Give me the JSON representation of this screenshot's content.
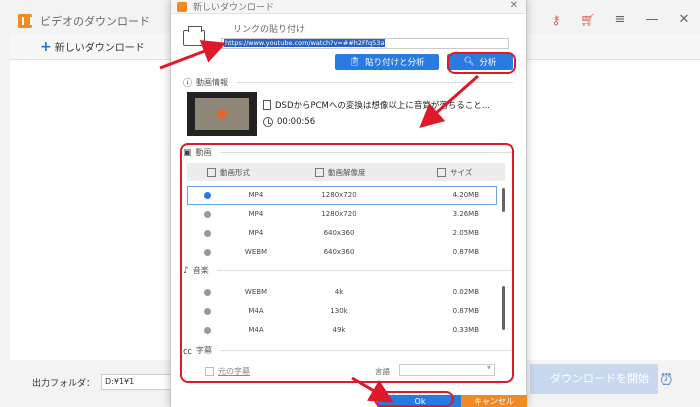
{
  "main_window": {
    "title": "ビデオのダウンロード",
    "new_download_label": "新しいダウンロード",
    "output_folder_label": "出力フォルダ：",
    "output_folder_value": "D:¥1¥1",
    "start_download_label": "ダウンロードを開始",
    "icons": [
      "app-icon",
      "key-icon",
      "cart-icon",
      "menu-icon",
      "minimize-icon",
      "close-icon",
      "alarm-icon"
    ]
  },
  "dialog": {
    "title": "新しいダウンロード",
    "close_label": "✕",
    "paste_label": "リンクの貼り付け",
    "url_value": "https://www.youtube.com/watch?v=##h2Ffq53a",
    "paste_analyze_label": "貼り付けと分析",
    "analyze_label": "分析",
    "video_info_heading": "動画情報",
    "video_title": "DSDからPCMへの変換は想像以上に音質が落ちること...",
    "video_duration": "00:00:56",
    "video_section": {
      "heading": "動画",
      "columns": [
        "動画形式",
        "動画解像度",
        "サイズ"
      ],
      "rows": [
        {
          "format": "MP4",
          "resolution": "1280x720",
          "size": "4.20MB",
          "selected": true
        },
        {
          "format": "MP4",
          "resolution": "1280x720",
          "size": "3.26MB",
          "selected": false
        },
        {
          "format": "MP4",
          "resolution": "640x360",
          "size": "2.05MB",
          "selected": false
        },
        {
          "format": "WEBM",
          "resolution": "640x360",
          "size": "0.87MB",
          "selected": false
        }
      ]
    },
    "audio_section": {
      "heading": "音楽",
      "rows": [
        {
          "format": "WEBM",
          "bitrate": "4k",
          "size": "0.02MB"
        },
        {
          "format": "M4A",
          "bitrate": "130k",
          "size": "0.87MB"
        },
        {
          "format": "M4A",
          "bitrate": "49k",
          "size": "0.33MB"
        }
      ]
    },
    "subtitle_section": {
      "heading": "字幕",
      "original_subtitle_label": "元の字幕",
      "language_label": "言語",
      "language_value": ""
    },
    "ok_label": "Ok",
    "cancel_label": "キャンセル"
  },
  "colors": {
    "accent_blue": "#2a7be0",
    "accent_orange": "#f08a24",
    "annotation_red": "#e0192a"
  }
}
